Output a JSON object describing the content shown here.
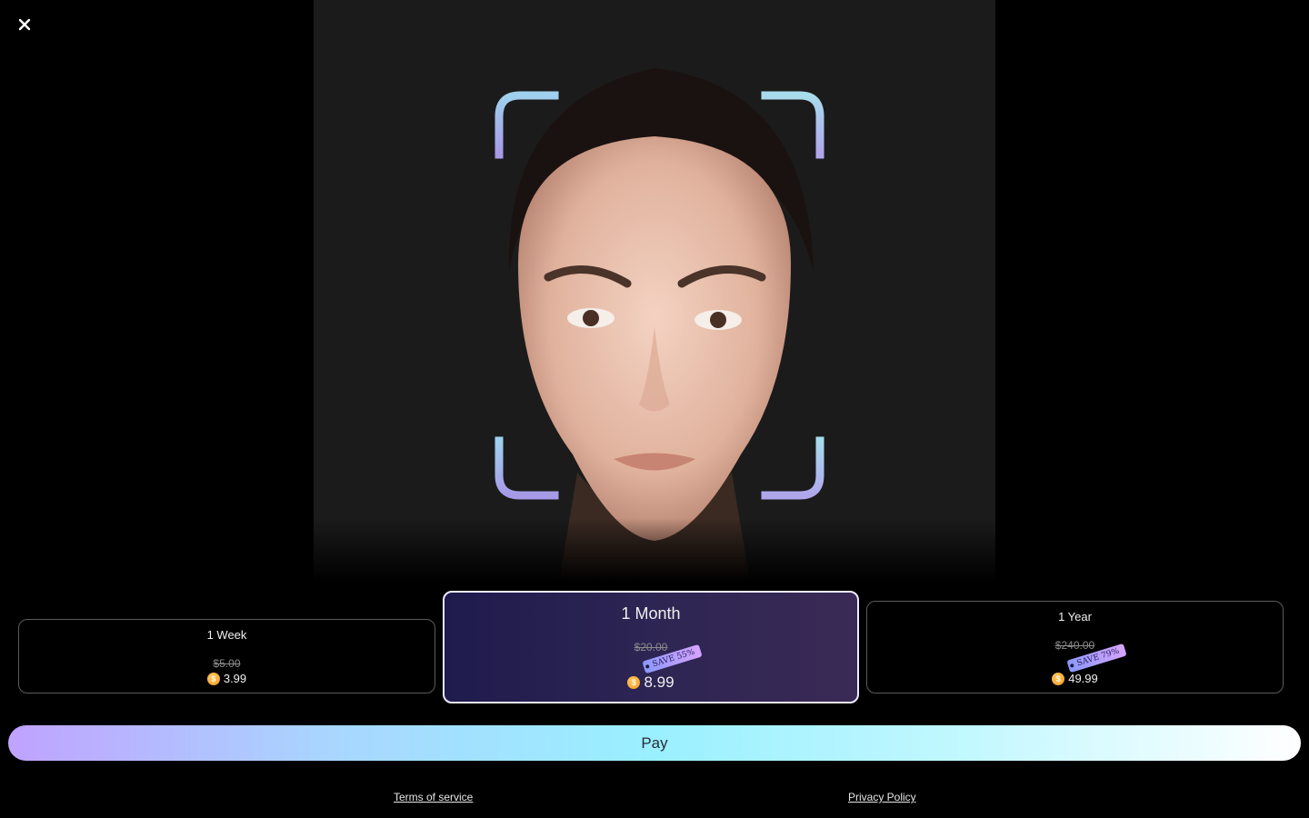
{
  "header": {
    "close_icon": "close-icon"
  },
  "hero": {
    "description_icon": "face-scan-icon"
  },
  "plans": [
    {
      "name": "1 Week",
      "old_price": "$5.00",
      "price": "3.99",
      "save_label": "",
      "selected": false
    },
    {
      "name": "1 Month",
      "old_price": "$20.00",
      "price": "8.99",
      "save_label": "SAVE 55%",
      "selected": true
    },
    {
      "name": "1 Year",
      "old_price": "$240.00",
      "price": "49.99",
      "save_label": "SAVE 79%",
      "selected": false
    }
  ],
  "coin_symbol": "$",
  "pay": {
    "label": "Pay"
  },
  "footer": {
    "terms": "Terms of service",
    "privacy": "Privacy Policy"
  },
  "colors": {
    "accent_start": "#c0a2ff",
    "accent_end": "#ffffff",
    "selected_plan_bg": "#2d2553"
  }
}
